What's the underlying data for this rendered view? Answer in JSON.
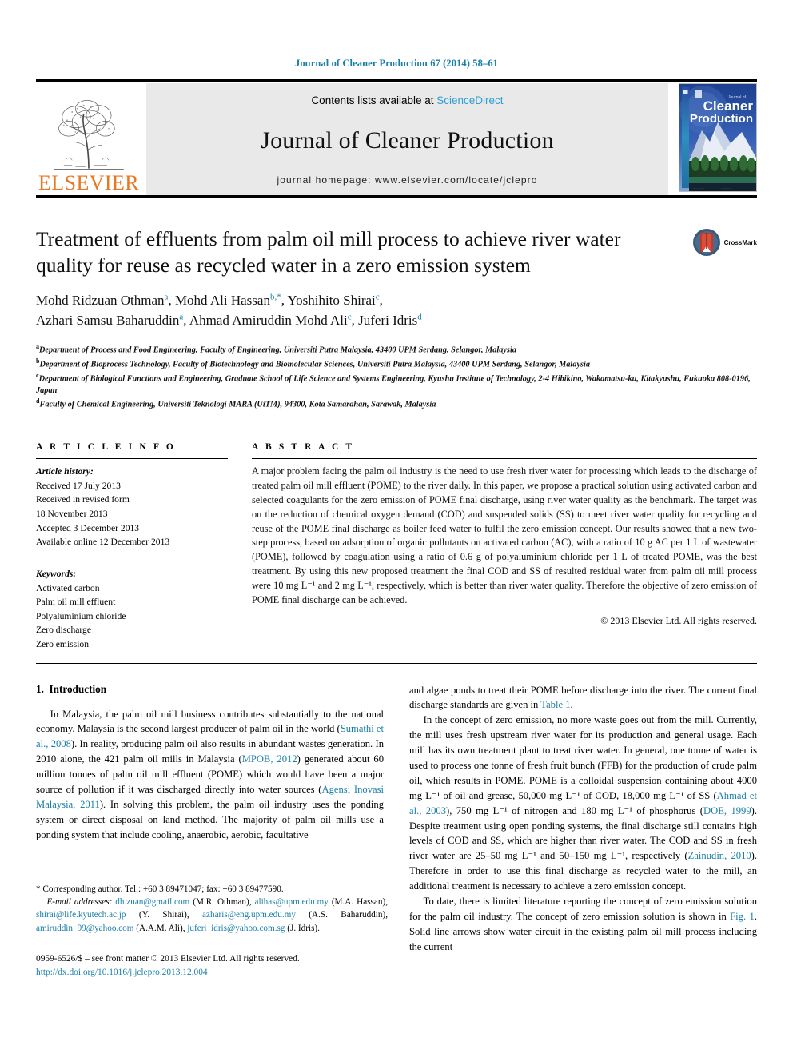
{
  "running_head": "Journal of Cleaner Production 67 (2014) 58–61",
  "masthead": {
    "publisher_name": "ELSEVIER",
    "contents_prefix": "Contents lists available at ",
    "sciencedirect": "ScienceDirect",
    "journal_title": "Journal of Cleaner Production",
    "homepage": "journal homepage: www.elsevier.com/locate/jclepro",
    "cover_line1": "Journal of",
    "cover_line2": "Cleaner",
    "cover_line3": "Production"
  },
  "article": {
    "title": "Treatment of effluents from palm oil mill process to achieve river water quality for reuse as recycled water in a zero emission system",
    "crossmark_label": "CrossMark",
    "authors_line1_pre": "Mohd Ridzuan Othman",
    "authors_line1_a": "a",
    "authors_line1_mid": ", Mohd Ali Hassan",
    "authors_line1_b": "b,*",
    "authors_line1_mid2": ", Yoshihito Shirai",
    "authors_line1_c": "c",
    "authors_line1_end": ",",
    "authors_line2_pre": "Azhari Samsu Baharuddin",
    "authors_line2_a": "a",
    "authors_line2_mid": ", Ahmad Amiruddin Mohd Ali",
    "authors_line2_c": "c",
    "authors_line2_mid2": ", Juferi Idris",
    "authors_line2_d": "d",
    "affiliations": [
      {
        "marker": "a",
        "text": "Department of Process and Food Engineering, Faculty of Engineering, Universiti Putra Malaysia, 43400 UPM Serdang, Selangor, Malaysia"
      },
      {
        "marker": "b",
        "text": "Department of Bioprocess Technology, Faculty of Biotechnology and Biomolecular Sciences, Universiti Putra Malaysia, 43400 UPM Serdang, Selangor, Malaysia"
      },
      {
        "marker": "c",
        "text": "Department of Biological Functions and Engineering, Graduate School of Life Science and Systems Engineering, Kyushu Institute of Technology, 2-4 Hibikino, Wakamatsu-ku, Kitakyushu, Fukuoka 808-0196, Japan"
      },
      {
        "marker": "d",
        "text": "Faculty of Chemical Engineering, Universiti Teknologi MARA (UiTM), 94300, Kota Samarahan, Sarawak, Malaysia"
      }
    ]
  },
  "article_info": {
    "heading": "A R T I C L E  I N F O",
    "history_label": "Article history:",
    "history": [
      "Received 17 July 2013",
      "Received in revised form",
      "18 November 2013",
      "Accepted 3 December 2013",
      "Available online 12 December 2013"
    ],
    "keywords_label": "Keywords:",
    "keywords": [
      "Activated carbon",
      "Palm oil mill effluent",
      "Polyaluminium chloride",
      "Zero discharge",
      "Zero emission"
    ]
  },
  "abstract": {
    "heading": "A B S T R A C T",
    "text": "A major problem facing the palm oil industry is the need to use fresh river water for processing which leads to the discharge of treated palm oil mill effluent (POME) to the river daily. In this paper, we propose a practical solution using activated carbon and selected coagulants for the zero emission of POME final discharge, using river water quality as the benchmark. The target was on the reduction of chemical oxygen demand (COD) and suspended solids (SS) to meet river water quality for recycling and reuse of the POME final discharge as boiler feed water to fulfil the zero emission concept. Our results showed that a new two-step process, based on adsorption of organic pollutants on activated carbon (AC), with a ratio of 10 g AC per 1 L of wastewater (POME), followed by coagulation using a ratio of 0.6 g of polyaluminium chloride per 1 L of treated POME, was the best treatment. By using this new proposed treatment the final COD and SS of resulted residual water from palm oil mill process were 10 mg L⁻¹ and 2 mg L⁻¹, respectively, which is better than river water quality. Therefore the objective of zero emission of POME final discharge can be achieved.",
    "copyright": "© 2013 Elsevier Ltd. All rights reserved."
  },
  "introduction": {
    "section_number": "1.",
    "section_title": "Introduction",
    "left_para1_part1": "In Malaysia, the palm oil mill business contributes substantially to the national economy. Malaysia is the second largest producer of palm oil in the world (",
    "left_para1_ref1": "Sumathi et al., 2008",
    "left_para1_part2": "). In reality, producing palm oil also results in abundant wastes generation. In 2010 alone, the 421 palm oil mills in Malaysia (",
    "left_para1_ref2": "MPOB, 2012",
    "left_para1_part3": ") generated about 60 million tonnes of palm oil mill effluent (POME) which would have been a major source of pollution if it was discharged directly into water sources (",
    "left_para1_ref3": "Agensi Inovasi Malaysia, 2011",
    "left_para1_part4": "). In solving this problem, the palm oil industry uses the ponding system or direct disposal on land method. The majority of palm oil mills use a ponding system that include cooling, anaerobic, aerobic, facultative",
    "right_para1_part1": "and algae ponds to treat their POME before discharge into the river. The current final discharge standards are given in ",
    "right_para1_ref1": "Table 1",
    "right_para1_part2": ".",
    "right_para2_part1": "In the concept of zero emission, no more waste goes out from the mill. Currently, the mill uses fresh upstream river water for its production and general usage. Each mill has its own treatment plant to treat river water. In general, one tonne of water is used to process one tonne of fresh fruit bunch (FFB) for the production of crude palm oil, which results in POME. POME is a colloidal suspension containing about 4000 mg L⁻¹ of oil and grease, 50,000 mg L⁻¹ of COD, 18,000 mg L⁻¹ of SS (",
    "right_para2_ref1": "Ahmad et al., 2003",
    "right_para2_part2": "), 750 mg L⁻¹ of nitrogen and 180 mg L⁻¹ of phosphorus (",
    "right_para2_ref2": "DOE, 1999",
    "right_para2_part3": "). Despite treatment using open ponding systems, the final discharge still contains high levels of COD and SS, which are higher than river water. The COD and SS in fresh river water are 25–50 mg L⁻¹ and 50–150 mg L⁻¹, respectively (",
    "right_para2_ref3": "Zainudin, 2010",
    "right_para2_part4": "). Therefore in order to use this final discharge as recycled water to the mill, an additional treatment is necessary to achieve a zero emission concept.",
    "right_para3_part1": "To date, there is limited literature reporting the concept of zero emission solution for the palm oil industry. The concept of zero emission solution is shown in ",
    "right_para3_ref1": "Fig. 1",
    "right_para3_part2": ". Solid line arrows show water circuit in the existing palm oil mill process including the current"
  },
  "footnotes": {
    "corresponding": "* Corresponding author. Tel.: +60 3 89471047; fax: +60 3 89477590.",
    "email_label": "E-mail addresses:",
    "emails": [
      {
        "addr": "dh.zuan@gmail.com",
        "name": " (M.R. Othman), "
      },
      {
        "addr": "alihas@upm.edu.my",
        "name": " (M.A. Hassan), "
      },
      {
        "addr": "shirai@life.kyutech.ac.jp",
        "name": " (Y. Shirai), "
      },
      {
        "addr": "azharis@eng.upm.edu.my",
        "name": " (A.S. Baharuddin), "
      },
      {
        "addr": "amiruddin_99@yahoo.com",
        "name": " (A.A.M. Ali), "
      },
      {
        "addr": "juferi_idris@yahoo.com.sg",
        "name": " (J. Idris)."
      }
    ],
    "issn": "0959-6526/$ – see front matter © 2013 Elsevier Ltd. All rights reserved.",
    "doi": "http://dx.doi.org/10.1016/j.jclepro.2013.12.004"
  },
  "colors": {
    "link": "#1a7fa8",
    "sciencedirect": "#2e9fd4",
    "elsevier_orange": "#E87722",
    "panel_gray": "#e9e9e9"
  }
}
